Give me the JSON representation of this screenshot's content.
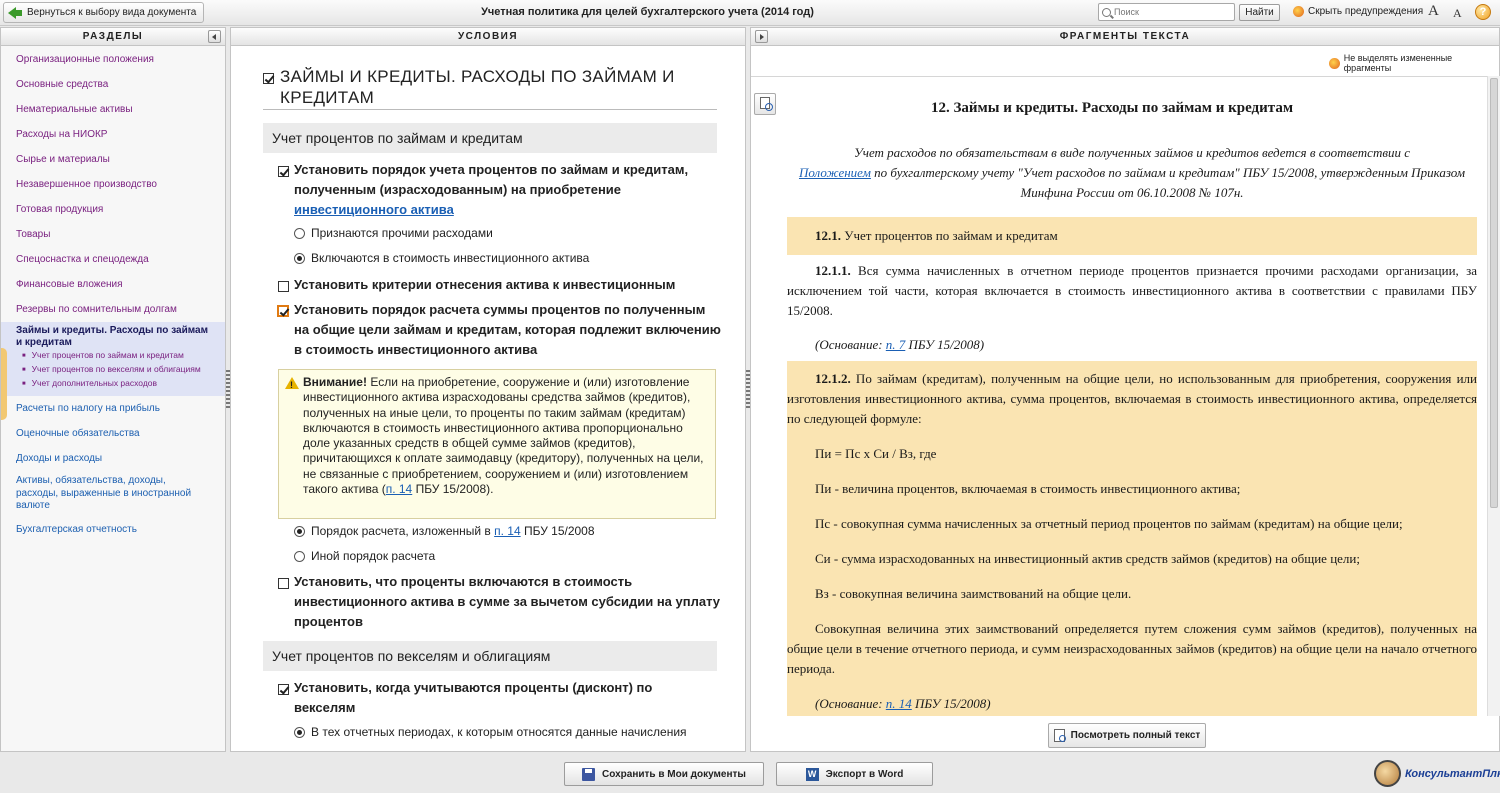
{
  "topbar": {
    "back_label": "Вернуться к выбору вида документа",
    "title": "Учетная политика для целей бухгалтерского учета (2014 год)",
    "search_placeholder": "Поиск",
    "find_label": "Найти",
    "hide_warnings_label": "Скрыть предупреждения",
    "font_up": "A",
    "font_down": "A",
    "help": "?"
  },
  "sections": {
    "header": "РАЗДЕЛЫ",
    "items": [
      {
        "label": "Организационные положения"
      },
      {
        "label": "Основные средства"
      },
      {
        "label": "Нематериальные активы"
      },
      {
        "label": "Расходы на НИОКР"
      },
      {
        "label": "Сырье и материалы"
      },
      {
        "label": "Незавершенное производство"
      },
      {
        "label": "Готовая продукция"
      },
      {
        "label": "Товары"
      },
      {
        "label": "Спецоснастка и спецодежда"
      },
      {
        "label": "Финансовые вложения"
      },
      {
        "label": "Резервы по сомнительным долгам"
      }
    ],
    "active": {
      "title": "Займы и кредиты. Расходы по займам и кредитам",
      "subs": [
        "Учет процентов по займам и кредитам",
        "Учет процентов по векселям и облигациям",
        "Учет дополнительных расходов"
      ]
    },
    "after_items": [
      {
        "label": "Расчеты по налогу на прибыль"
      },
      {
        "label": "Оценочные обязательства"
      },
      {
        "label": "Доходы и расходы"
      },
      {
        "label": "Активы, обязательства, доходы, расходы, выраженные в иностранной валюте"
      },
      {
        "label": "Бухгалтерская отчетность"
      }
    ]
  },
  "conditions": {
    "header": "УСЛОВИЯ",
    "title": "ЗАЙМЫ И КРЕДИТЫ. РАСХОДЫ ПО ЗАЙМАМ И КРЕДИТАМ",
    "sec1": "Учет процентов по займам и кредитам",
    "q1": "Установить порядок учета процентов по займам и кредитам, полученным (израсходованным) на приобретение",
    "q1_link": "инвестиционного актива",
    "q1_opt1": "Признаются прочими расходами",
    "q1_opt2": "Включаются в стоимость инвестиционного актива",
    "q2": "Установить критерии отнесения актива к инвестиционным",
    "q3": "Установить порядок расчета суммы процентов по полученным на общие цели займам и кредитам, которая подлежит включению в стоимость инвестиционного актива",
    "warn_bold": "Внимание!",
    "warn_text": " Если на приобретение, сооружение и (или) изготовление инвестиционного актива израсходованы средства займов (кредитов), полученных на иные цели, то проценты по таким займам (кредитам) включаются в стоимость инвестиционного актива пропорционально доле указанных средств в общей сумме займов (кредитов), причитающихся к оплате заимодавцу (кредитору), полученных на цели, не связанные с приобретением, сооружением и (или) изготовлением такого актива (",
    "warn_link": "п. 14",
    "warn_end": " ПБУ 15/2008).",
    "q3_opt1_pre": "Порядок расчета, изложенный в ",
    "q3_opt1_link": "п. 14",
    "q3_opt1_post": " ПБУ 15/2008",
    "q3_opt2": "Иной порядок расчета",
    "q4": "Установить, что проценты включаются в стоимость инвестиционного актива в сумме за вычетом субсидии на уплату процентов",
    "sec2": "Учет процентов по векселям и облигациям",
    "q5": "Установить, когда учитываются проценты (дисконт) по векселям",
    "q5_opt1": "В тех отчетных периодах, к которым относятся данные начисления"
  },
  "fragments": {
    "header": "ФРАГМЕНТЫ ТЕКСТА",
    "highlight_label": "Не выделять измененные фрагменты",
    "heading_num": "12.",
    "heading": " Займы и кредиты. Расходы по займам и кредитам",
    "intro_1": "Учет расходов по обязательствам в виде полученных займов и кредитов ведется в соответствии с",
    "intro_link": "Положением",
    "intro_2": " по бухгалтерскому учету \"Учет расходов по займам и кредитам\" ПБУ 15/2008, утвержденным Приказом Минфина России от 06.10.2008 № 107н.",
    "s121_num": "12.1.",
    "s121": " Учет процентов по займам и кредитам",
    "s1211_num": "12.1.1.",
    "s1211": " Вся сумма начисленных в отчетном периоде процентов признается прочими расходами организации, за исключением той части, которая включается в стоимость инвестиционного актива в соответствии с правилами ПБУ 15/2008.",
    "basis1_pre": "(Основание: ",
    "basis1_link": "п. 7",
    "basis1_post": " ПБУ 15/2008)",
    "s1212_num": "12.1.2.",
    "s1212": " По займам (кредитам), полученным на общие цели, но использованным для приобретения, сооружения или изготовления инвестиционного актива, сумма процентов, включаемая в стоимость инвестиционного актива, определяется по следующей формуле:",
    "formula": "Пи = Пс х Си / Вз, где",
    "def1": "Пи - величина процентов, включаемая в стоимость инвестиционного актива;",
    "def2": "Пс - совокупная сумма начисленных за отчетный период процентов по займам (кредитам) на общие цели;",
    "def3": "Си - сумма израсходованных на инвестиционный актив средств займов (кредитов) на общие цели;",
    "def4": "Вз - совокупная величина заимствований на общие цели.",
    "def5": "Совокупная величина этих заимствований определяется путем сложения сумм займов (кредитов), полученных на общие цели в течение отчетного периода, и сумм неизрасходованных займов (кредитов) на общие цели на начало отчетного периода.",
    "basis2_pre": "(Основание: ",
    "basis2_link": "п. 14",
    "basis2_post": " ПБУ 15/2008)",
    "view_full_label": "Посмотреть полный текст"
  },
  "bottom": {
    "save_label": "Сохранить в Мои документы",
    "export_label": "Экспорт в Word",
    "logo_text": "КонсультантПлюс"
  }
}
